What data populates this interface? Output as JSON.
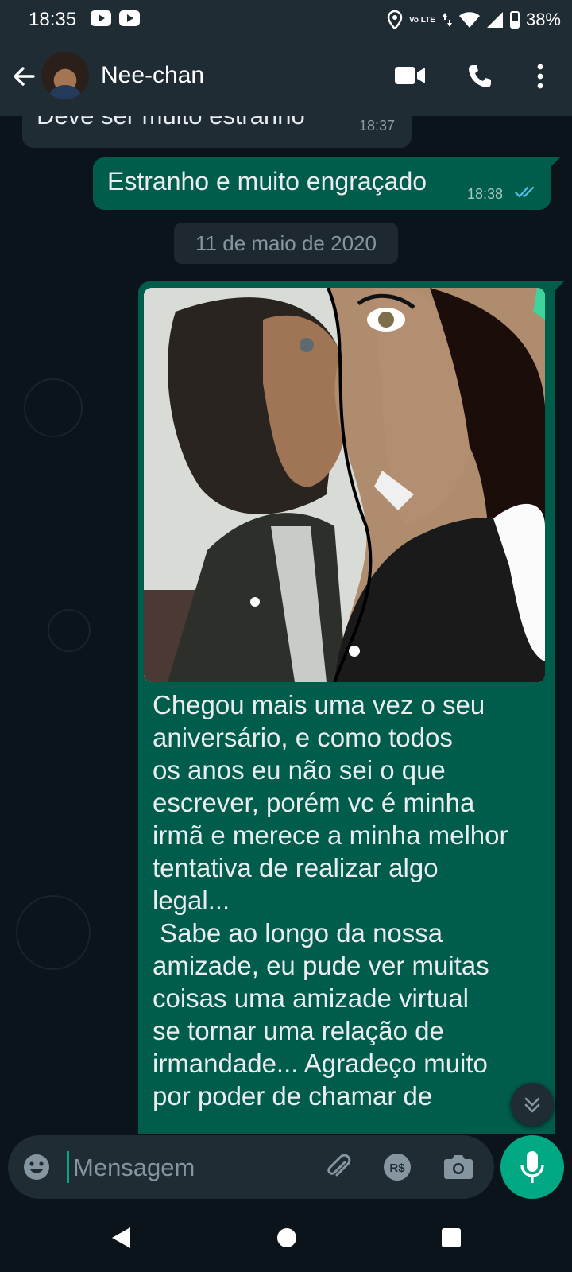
{
  "status_bar": {
    "time": "18:35",
    "network": "Vo LTE",
    "battery": "38%"
  },
  "header": {
    "contact_name": "Nee-chan",
    "icons": [
      "back-arrow-icon",
      "video-call-icon",
      "phone-icon",
      "more-vert-icon"
    ]
  },
  "messages": [
    {
      "direction": "incoming",
      "text": "Deve ser muito estranho",
      "time": "18:37"
    },
    {
      "direction": "outgoing",
      "text": "Estranho e muito engraçado",
      "time": "18:38",
      "status": "read"
    }
  ],
  "date_separator": "11 de maio de 2020",
  "image_message": {
    "direction": "outgoing",
    "caption": "Chegou mais uma vez o seu\naniversário, e como todos\nos anos eu não sei o que\nescrever, porém vc é minha\nirmã e merece a minha melhor\ntentativa de realizar algo\nlegal...\n Sabe ao longo da nossa\namizade, eu pude ver muitas\ncoisas uma amizade virtual\nse tornar uma relação de\nirmandade... Agradeço muito\npor poder de chamar de"
  },
  "input": {
    "placeholder": "Mensagem"
  },
  "colors": {
    "header_bg": "#1f2c34",
    "chat_bg": "#0b141a",
    "outgoing_bubble": "#005c4b",
    "incoming_bubble": "#1f2c34",
    "accent": "#00a884",
    "read_ticks": "#53bdeb"
  }
}
